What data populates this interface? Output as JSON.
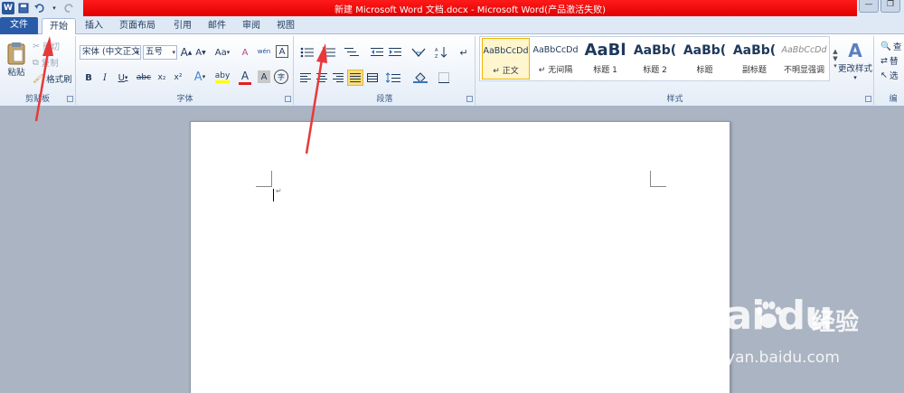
{
  "window": {
    "title": "新建 Microsoft Word 文档.docx - Microsoft Word(产品激活失败)",
    "controls": [
      "—",
      "❐"
    ]
  },
  "qat": {
    "app_icon": "W",
    "save_icon": "save-icon",
    "undo_icon": "undo-icon",
    "redo_icon": "redo-icon"
  },
  "tabs": [
    "文件",
    "开始",
    "插入",
    "页面布局",
    "引用",
    "邮件",
    "审阅",
    "视图"
  ],
  "clipboard": {
    "paste": "粘贴",
    "cut": "剪切",
    "copy": "复制",
    "format_painter": "格式刷",
    "label": "剪贴板"
  },
  "font": {
    "family": "宋体 (中文正文)",
    "size": "五号",
    "grow": "A",
    "shrink": "A",
    "change_case": "Aa",
    "clear_format": "A",
    "phonetic": "wén",
    "border_char": "A",
    "bold": "B",
    "italic": "I",
    "underline": "U",
    "strike": "abc",
    "subscript": "x₂",
    "superscript": "x²",
    "text_effect": "A",
    "highlight": "aby",
    "font_color": "A",
    "shading": "A",
    "enclose": "字",
    "label": "字体"
  },
  "paragraph": {
    "label": "段落"
  },
  "styles": {
    "items": [
      {
        "sample": "AaBbCcDd",
        "name": "↵ 正文"
      },
      {
        "sample": "AaBbCcDd",
        "name": "↵ 无间隔"
      },
      {
        "sample": "AaBl",
        "name": "标题 1"
      },
      {
        "sample": "AaBb(",
        "name": "标题 2"
      },
      {
        "sample": "AaBb(",
        "name": "标题"
      },
      {
        "sample": "AaBb(",
        "name": "副标题"
      },
      {
        "sample": "AaBbCcDd",
        "name": "不明显强调"
      }
    ],
    "change_styles": "更改样式",
    "label": "样式"
  },
  "editing": {
    "find": "查",
    "replace": "替",
    "select": "选",
    "label": "编"
  },
  "watermark": {
    "logo": "Bai  du",
    "cn": "经验",
    "url": "jingyan.baidu.com"
  },
  "colors": {
    "title_red": "#e00000",
    "file_tab": "#2a5ba8",
    "arrow": "#e8393a",
    "highlight": "#ffff00",
    "font_red": "#e02020"
  }
}
